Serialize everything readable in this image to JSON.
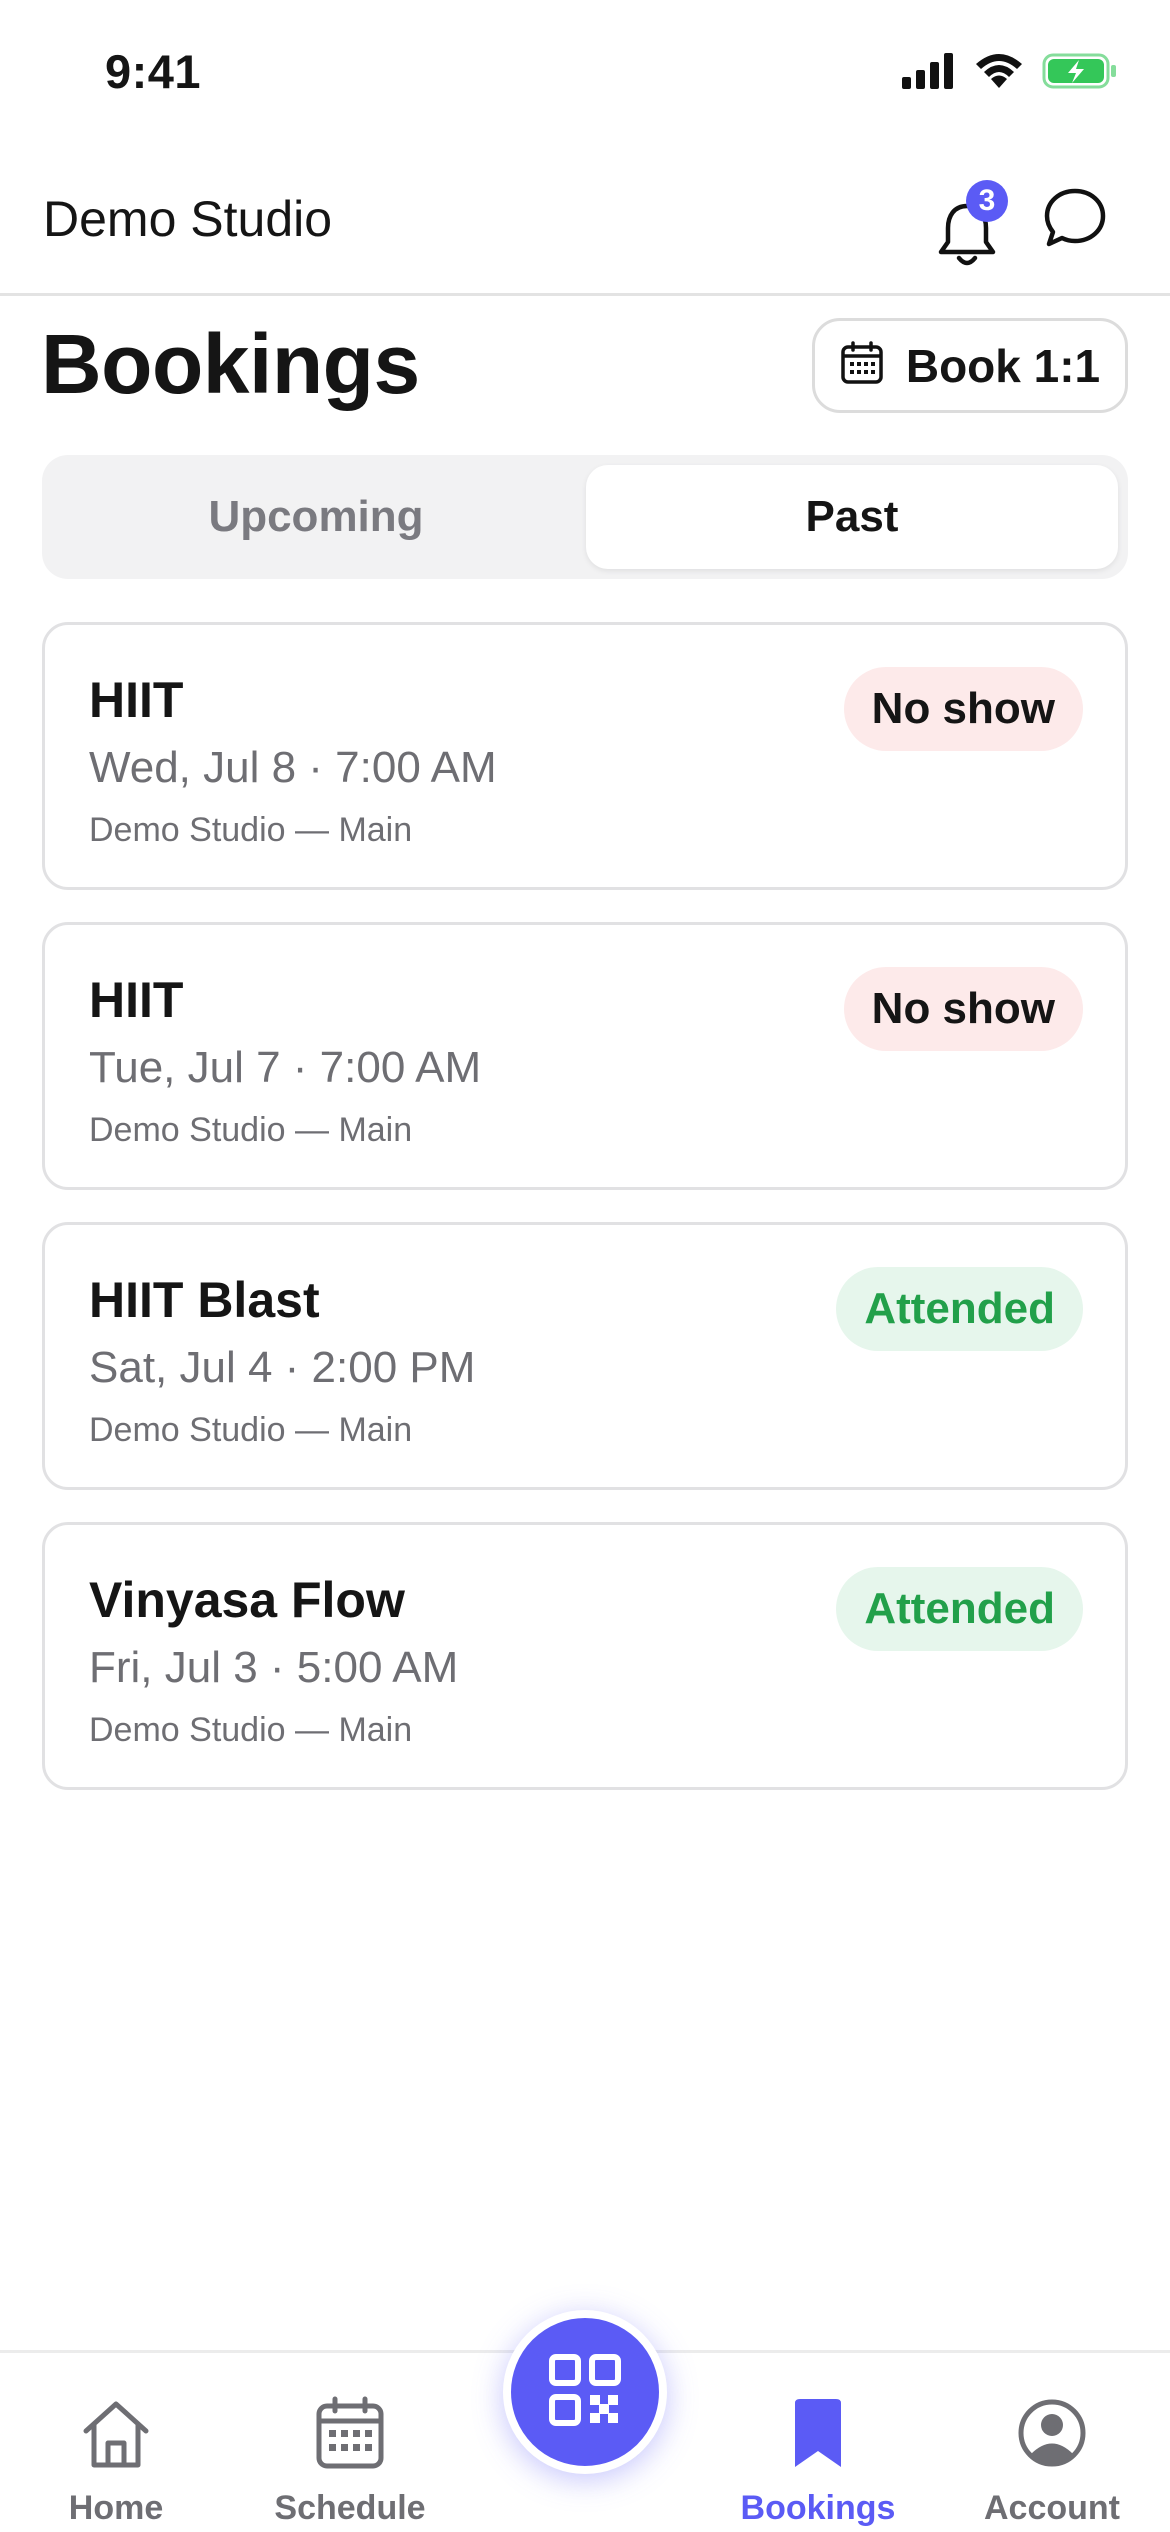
{
  "status_bar": {
    "time": "9:41"
  },
  "header": {
    "studio_name": "Demo Studio",
    "notification_count": "3"
  },
  "page": {
    "title": "Bookings",
    "book_button_label": "Book 1:1"
  },
  "tabs": [
    {
      "label": "Upcoming",
      "selected": false
    },
    {
      "label": "Past",
      "selected": true
    }
  ],
  "bookings": [
    {
      "class_name": "HIIT",
      "datetime": "Wed, Jul 8 · 7:00 AM",
      "location": "Demo Studio — Main",
      "status": "No show"
    },
    {
      "class_name": "HIIT",
      "datetime": "Tue, Jul 7 · 7:00 AM",
      "location": "Demo Studio — Main",
      "status": "No show"
    },
    {
      "class_name": "HIIT Blast",
      "datetime": "Sat, Jul 4 · 2:00 PM",
      "location": "Demo Studio — Main",
      "status": "Attended"
    },
    {
      "class_name": "Vinyasa Flow",
      "datetime": "Fri, Jul 3 · 5:00 AM",
      "location": "Demo Studio — Main",
      "status": "Attended"
    }
  ],
  "bottom_nav": [
    {
      "label": "Home",
      "icon": "home-icon",
      "active": false
    },
    {
      "label": "Schedule",
      "icon": "calendar-icon",
      "active": false
    },
    {
      "label": "Bookings",
      "icon": "bookmark-icon",
      "active": true
    },
    {
      "label": "Account",
      "icon": "user-circle-icon",
      "active": false
    }
  ],
  "colors": {
    "accent": "#5b5bf5",
    "no_show_bg": "#fdeaea",
    "attended_bg": "#e6f6ec",
    "attended_text": "#22a04a",
    "battery": "#34c759"
  }
}
